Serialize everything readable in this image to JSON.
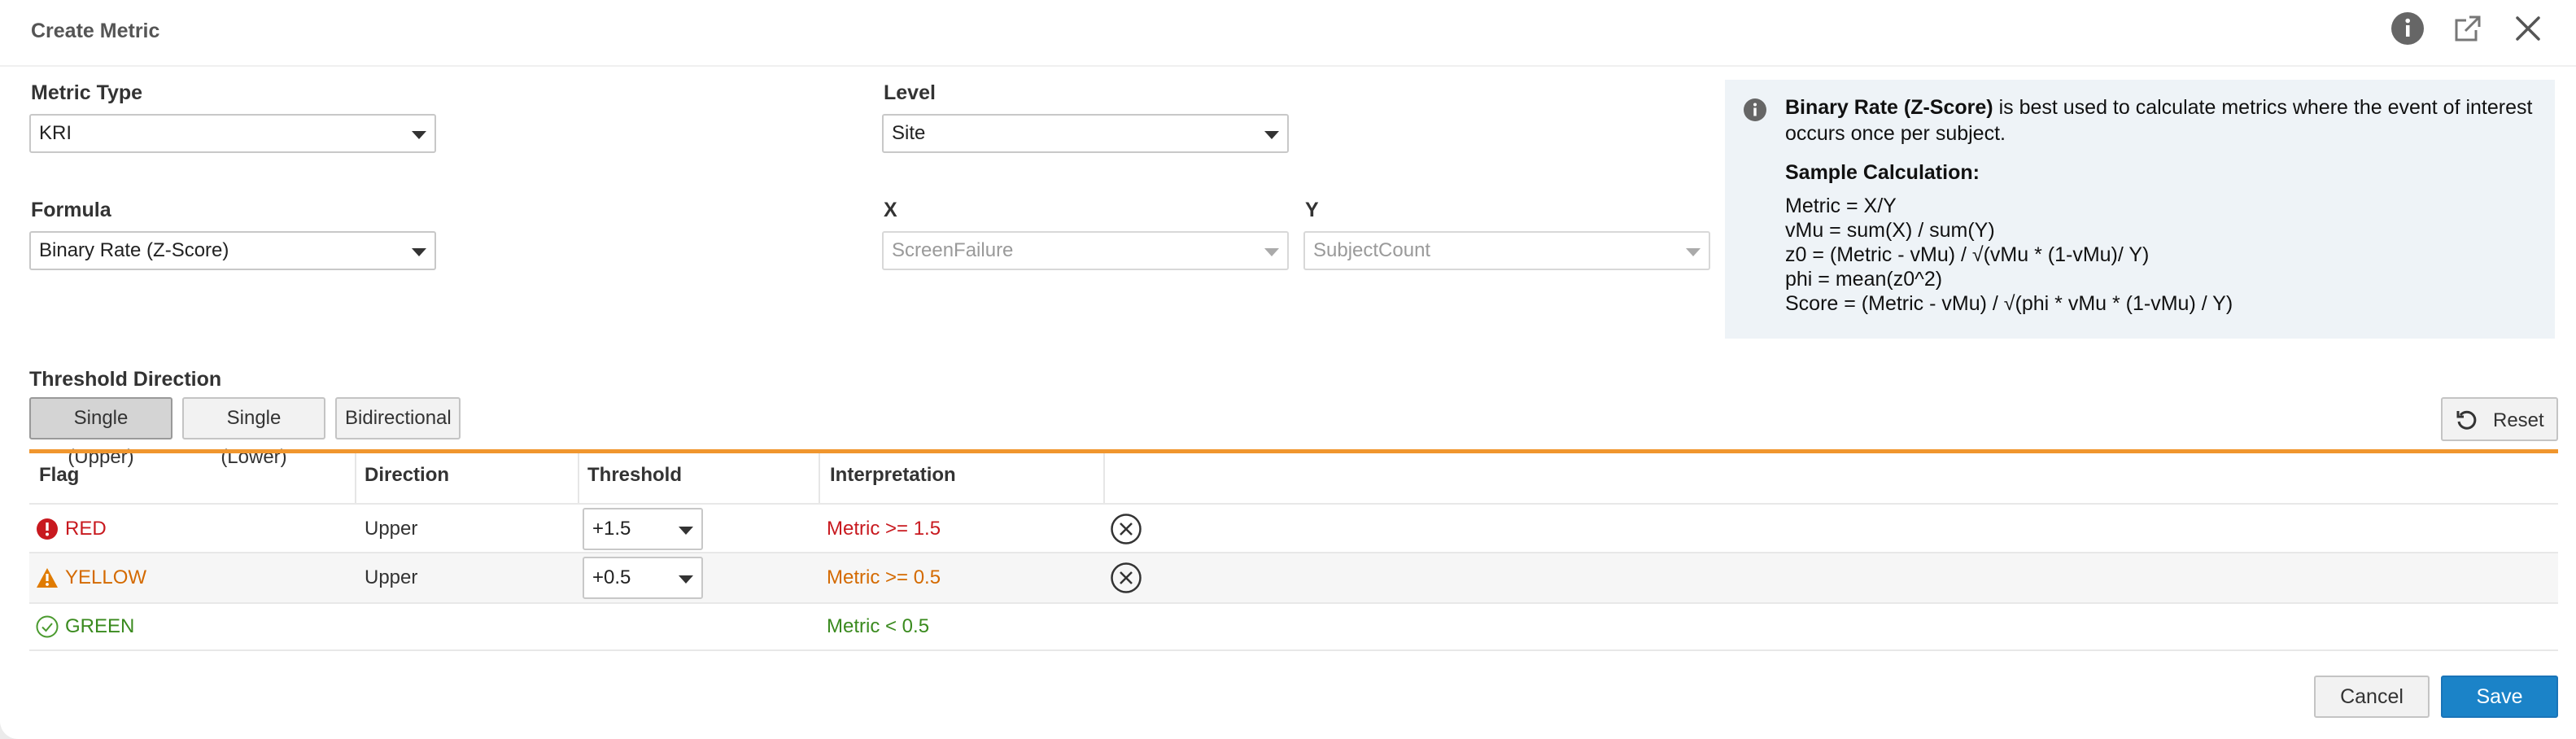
{
  "dialog": {
    "title": "Create Metric",
    "header_icons": [
      "info-icon",
      "external-link-icon",
      "close-icon"
    ]
  },
  "form": {
    "metric_type": {
      "label": "Metric Type",
      "value": "KRI"
    },
    "level": {
      "label": "Level",
      "value": "Site"
    },
    "formula": {
      "label": "Formula",
      "value": "Binary Rate (Z-Score)"
    },
    "x": {
      "label": "X",
      "value": "ScreenFailure"
    },
    "y": {
      "label": "Y",
      "value": "SubjectCount"
    }
  },
  "info_panel": {
    "name": "Binary Rate (Z-Score)",
    "description": " is best used to calculate metrics where the event of interest occurs once per subject.",
    "sample_heading": "Sample Calculation:",
    "lines": [
      "Metric = X/Y",
      "vMu = sum(X) / sum(Y)",
      "z0 = (Metric - vMu) / √(vMu * (1-vMu)/ Y)",
      "phi = mean(z0^2)",
      "Score = (Metric - vMu) / √(phi * vMu * (1-vMu) / Y)"
    ]
  },
  "threshold": {
    "label": "Threshold Direction",
    "options": [
      "Single (Upper)",
      "Single (Lower)",
      "Bidirectional"
    ],
    "selected": "Single (Upper)",
    "reset_label": "Reset"
  },
  "table": {
    "headers": [
      "Flag",
      "Direction",
      "Threshold",
      "Interpretation"
    ],
    "rows": [
      {
        "flag": "RED",
        "direction": "Upper",
        "threshold": "+1.5",
        "interpretation": "Metric >= 1.5",
        "color": "#c8191f",
        "icon": "error-icon"
      },
      {
        "flag": "YELLOW",
        "direction": "Upper",
        "threshold": "+0.5",
        "interpretation": "Metric >= 0.5",
        "color": "#d46a00",
        "icon": "warning-icon"
      },
      {
        "flag": "GREEN",
        "direction": "",
        "threshold": "",
        "interpretation": "Metric < 0.5",
        "color": "#3a8a1e",
        "icon": "check-circle-icon"
      }
    ]
  },
  "footer": {
    "cancel_label": "Cancel",
    "save_label": "Save"
  },
  "colors": {
    "accent": "#1b83c8",
    "divider": "#f0962e",
    "info_bg": "#eef3f7"
  }
}
